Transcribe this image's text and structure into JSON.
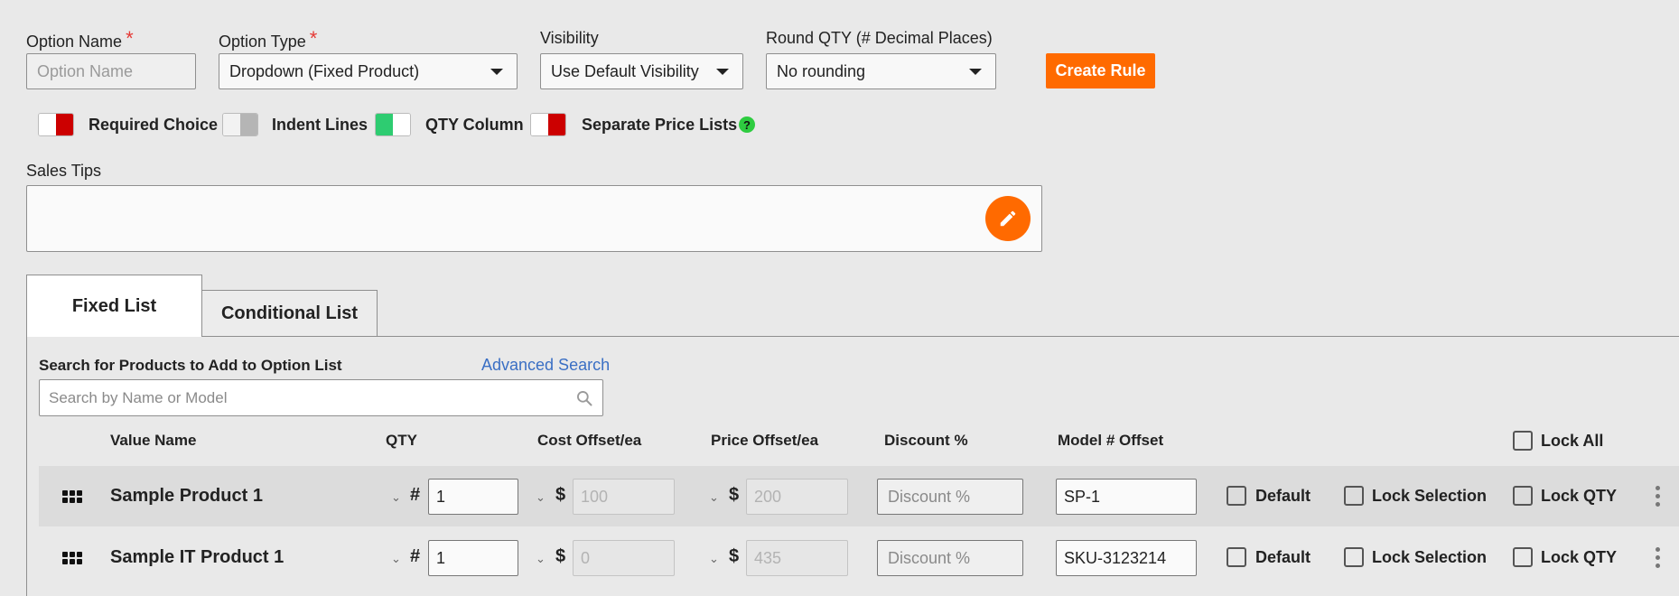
{
  "header": {
    "option_name": {
      "label": "Option Name",
      "required_mark": "*",
      "placeholder": "Option Name"
    },
    "option_type": {
      "label": "Option Type",
      "required_mark": "*",
      "value": "Dropdown (Fixed Product)"
    },
    "visibility": {
      "label": "Visibility",
      "value": "Use Default Visibility"
    },
    "round_qty": {
      "label": "Round QTY (# Decimal Places)",
      "value": "No rounding"
    },
    "create_rule_label": "Create Rule"
  },
  "toggles": [
    {
      "label": "Required Choice",
      "state": "off",
      "color": "#cc0000"
    },
    {
      "label": "Indent Lines",
      "state": "off",
      "color": "#b5b5b5"
    },
    {
      "label": "QTY Column",
      "state": "on",
      "color": "#2ecc71"
    },
    {
      "label": "Separate Price Lists",
      "state": "off",
      "color": "#cc0000"
    }
  ],
  "help_glyph": "?",
  "sales_tips": {
    "label": "Sales Tips",
    "value": ""
  },
  "tabs": [
    {
      "label": "Fixed List",
      "active": true
    },
    {
      "label": "Conditional List",
      "active": false
    }
  ],
  "search": {
    "label": "Search for Products to Add to Option List",
    "advanced_link": "Advanced Search",
    "placeholder": "Search by Name or Model"
  },
  "table": {
    "columns": {
      "value_name": "Value Name",
      "qty": "QTY",
      "cost_offset": "Cost Offset/ea",
      "price_offset": "Price Offset/ea",
      "discount": "Discount %",
      "model_offset": "Model # Offset",
      "lock_all": "Lock All"
    },
    "symbols": {
      "qty": "#",
      "cost": "$",
      "price": "$"
    },
    "rows": [
      {
        "name": "Sample Product 1",
        "qty": "1",
        "cost_offset": "100",
        "price_offset": "200",
        "discount_placeholder": "Discount %",
        "model_offset": "SP-1",
        "default_label": "Default",
        "lock_selection_label": "Lock Selection",
        "lock_qty_label": "Lock QTY"
      },
      {
        "name": "Sample IT Product 1",
        "qty": "1",
        "cost_offset": "0",
        "price_offset": "435",
        "discount_placeholder": "Discount %",
        "model_offset": "SKU-3123214",
        "default_label": "Default",
        "lock_selection_label": "Lock Selection",
        "lock_qty_label": "Lock QTY"
      }
    ]
  },
  "colors": {
    "accent": "#ff6a00",
    "link": "#3a6fc4",
    "required": "#e53935",
    "help": "#2ecc40"
  }
}
